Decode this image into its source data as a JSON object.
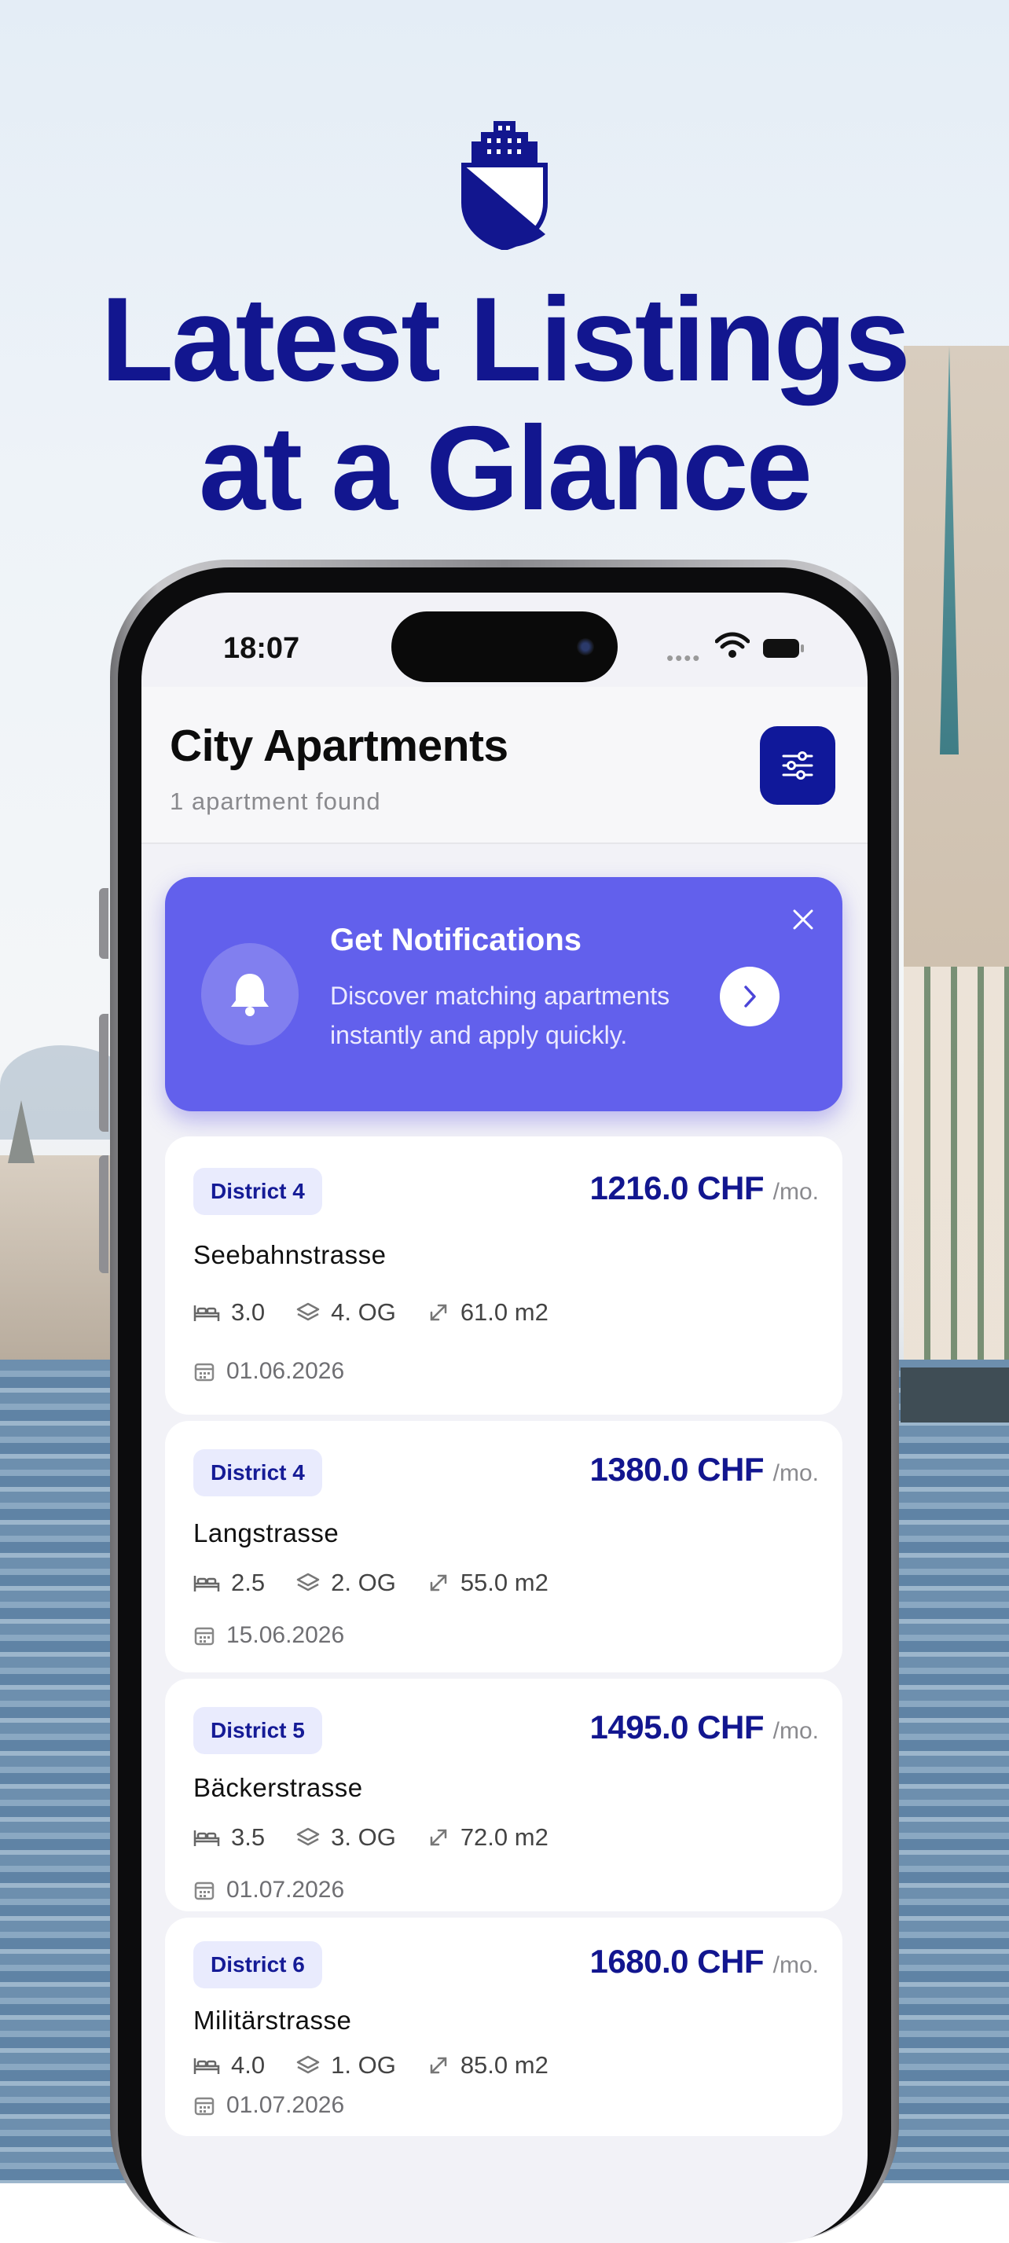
{
  "headline": {
    "line1": "Latest Listings",
    "line2": "at a Glance"
  },
  "status_bar": {
    "time": "18:07"
  },
  "header": {
    "title": "City Apartments",
    "subtitle": "1 apartment found"
  },
  "banner": {
    "title": "Get Notifications",
    "text": "Discover matching apartments instantly and apply quickly."
  },
  "listings": [
    {
      "district": "District 4",
      "price": "1216.0 CHF",
      "per": "/mo.",
      "street": "Seebahnstrasse",
      "rooms": "3.0",
      "floor": "4. OG",
      "area": "61.0 m2",
      "date": "01.06.2026"
    },
    {
      "district": "District 4",
      "price": "1380.0 CHF",
      "per": "/mo.",
      "street": "Langstrasse",
      "rooms": "2.5",
      "floor": "2. OG",
      "area": "55.0 m2",
      "date": "15.06.2026"
    },
    {
      "district": "District 5",
      "price": "1495.0 CHF",
      "per": "/mo.",
      "street": "Bäckerstrasse",
      "rooms": "3.5",
      "floor": "3. OG",
      "area": "72.0 m2",
      "date": "01.07.2026"
    },
    {
      "district": "District 6",
      "price": "1680.0 CHF",
      "per": "/mo.",
      "street": "Militärstrasse",
      "rooms": "4.0",
      "floor": "1. OG",
      "area": "85.0 m2",
      "date": "01.07.2026"
    }
  ],
  "icons": {
    "logo": "building-shield-icon",
    "filter": "sliders-icon",
    "bell": "bell-icon",
    "close": "close-icon",
    "go": "chevron-right-icon",
    "rooms": "bed-icon",
    "floor": "layers-icon",
    "area": "expand-arrow-icon",
    "date": "calendar-icon"
  },
  "colors": {
    "brand_navy": "#12168f",
    "banner_purple": "#6260ec",
    "badge_bg": "#e9ebfd"
  }
}
